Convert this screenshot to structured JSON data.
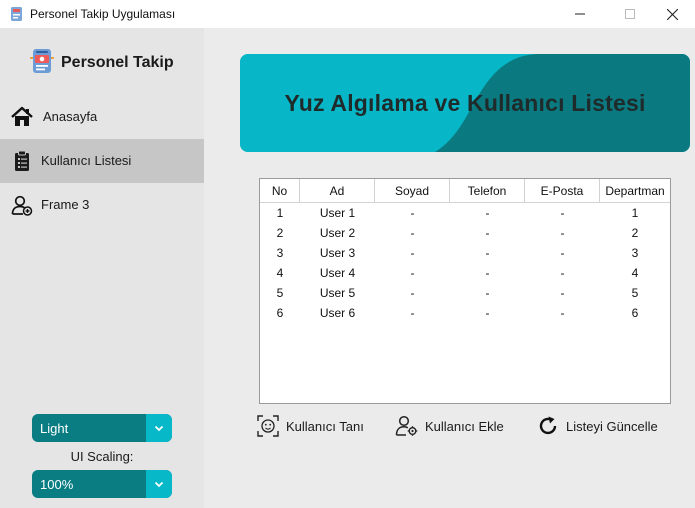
{
  "window": {
    "title": "Personel Takip Uygulaması",
    "icon": "app-icon"
  },
  "sidebar": {
    "brand": {
      "label": "Personel Takip",
      "icon": "app-logo-icon"
    },
    "items": [
      {
        "label": "Anasayfa",
        "icon": "home-icon",
        "active": false
      },
      {
        "label": "Kullanıcı Listesi",
        "icon": "clipboard-icon",
        "active": true
      },
      {
        "label": "Frame 3",
        "icon": "user-add-icon",
        "active": false
      }
    ],
    "appearance_mode": {
      "value": "Light"
    },
    "scaling_label": "UI Scaling:",
    "scaling": {
      "value": "100%"
    }
  },
  "banner": {
    "title": "Yuz Algılama ve Kullanıcı Listesi"
  },
  "table": {
    "columns": [
      "No",
      "Ad",
      "Soyad",
      "Telefon",
      "E-Posta",
      "Departman"
    ],
    "rows": [
      [
        "1",
        "User 1",
        "-",
        "-",
        "-",
        "1"
      ],
      [
        "2",
        "User 2",
        "-",
        "-",
        "-",
        "2"
      ],
      [
        "3",
        "User 3",
        "-",
        "-",
        "-",
        "3"
      ],
      [
        "4",
        "User 4",
        "-",
        "-",
        "-",
        "4"
      ],
      [
        "5",
        "User 5",
        "-",
        "-",
        "-",
        "5"
      ],
      [
        "6",
        "User 6",
        "-",
        "-",
        "-",
        "6"
      ]
    ]
  },
  "actions": {
    "recognize": {
      "label": "Kullanıcı Tanı",
      "icon": "face-scan-icon"
    },
    "add": {
      "label": "Kullanıcı Ekle",
      "icon": "user-settings-icon"
    },
    "refresh": {
      "label": "Listeyi Güncelle",
      "icon": "refresh-icon"
    }
  },
  "colors": {
    "accent": "#07b7c7",
    "accent_dark": "#0a7d83",
    "active_nav": "#c6c6c6"
  }
}
